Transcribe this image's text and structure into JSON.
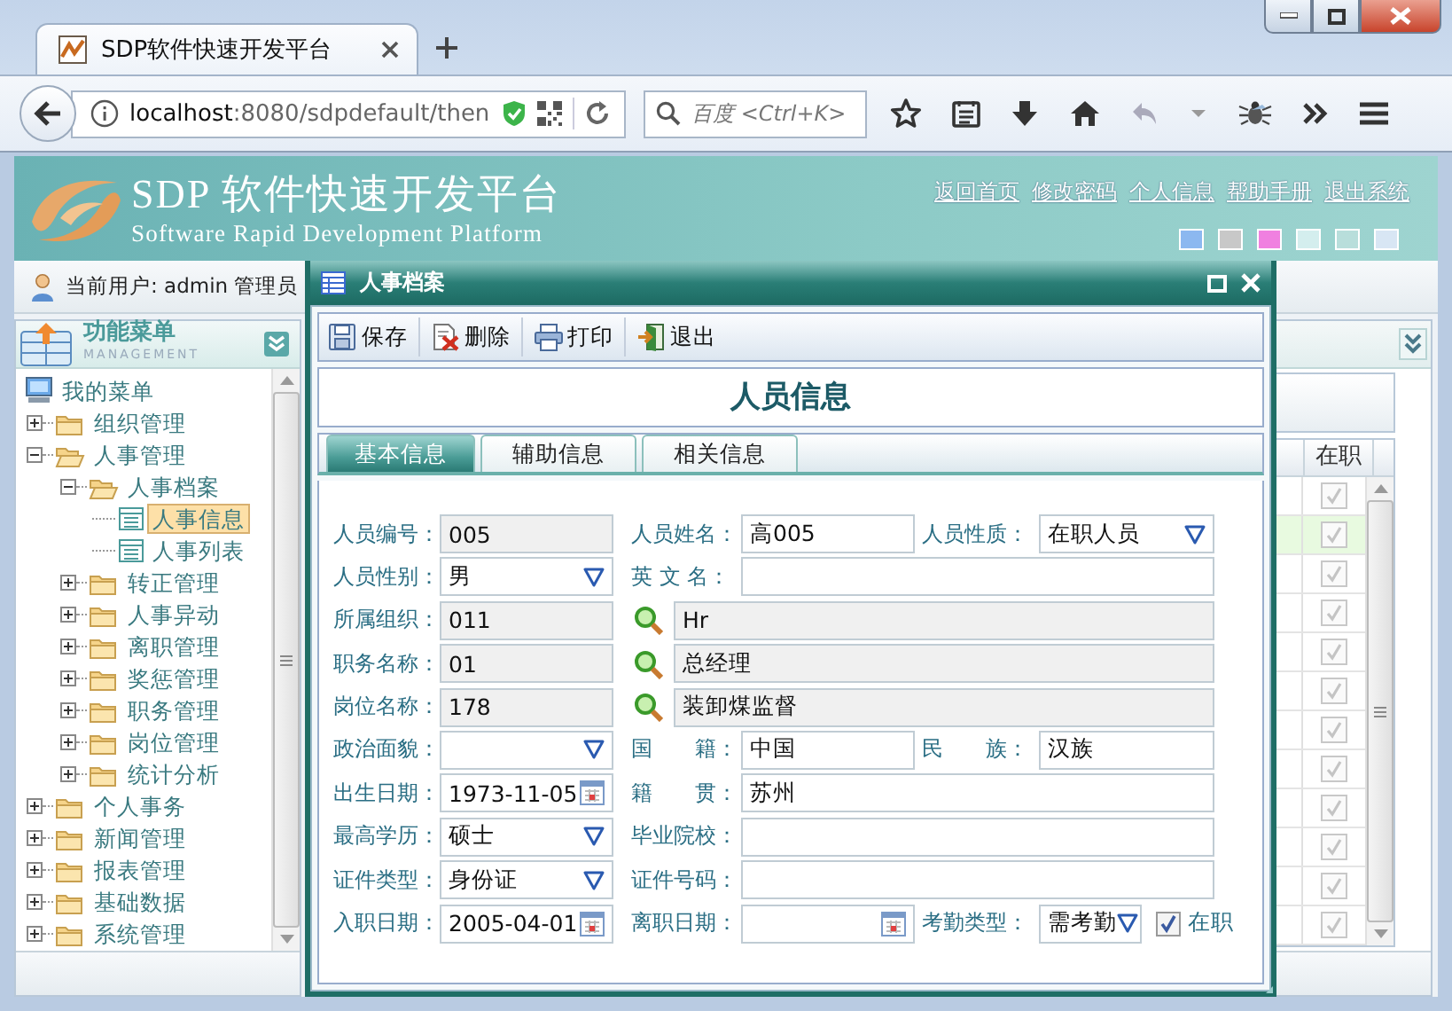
{
  "browser": {
    "tab_title": "SDP软件快速开发平台",
    "url_host": "localhost",
    "url_rest": ":8080/sdpdefault/then",
    "search_placeholder": "百度 <Ctrl+K>"
  },
  "header": {
    "title": "SDP 软件快速开发平台",
    "subtitle": "Software Rapid Development Platform",
    "links": [
      "返回首页",
      "修改密码",
      "个人信息",
      "帮助手册",
      "退出系统"
    ],
    "themes": [
      {
        "color": "#8cb8f0"
      },
      {
        "color": "#c8c8c8"
      },
      {
        "color": "#f080e0"
      },
      {
        "color": "#d4eeee"
      },
      {
        "color": "#b8dedb"
      },
      {
        "color": "#d8e6f4"
      }
    ]
  },
  "user_bar": {
    "text": "当前用户: admin 管理员"
  },
  "sidebar": {
    "title": "功能菜单",
    "subtitle": "MANAGEMENT",
    "tree": {
      "label": "我的菜单",
      "kind": "root",
      "selected": false,
      "children": [
        {
          "label": "组织管理",
          "kind": "folder",
          "expanded": false,
          "selected": false
        },
        {
          "label": "人事管理",
          "kind": "folder",
          "expanded": true,
          "selected": false,
          "children": [
            {
              "label": "人事档案",
              "kind": "folder",
              "expanded": true,
              "selected": false,
              "children": [
                {
                  "label": "人事信息",
                  "kind": "leaf",
                  "selected": true
                },
                {
                  "label": "人事列表",
                  "kind": "leaf",
                  "selected": false
                }
              ]
            },
            {
              "label": "转正管理",
              "kind": "folder",
              "expanded": false,
              "selected": false
            },
            {
              "label": "人事异动",
              "kind": "folder",
              "expanded": false,
              "selected": false
            },
            {
              "label": "离职管理",
              "kind": "folder",
              "expanded": false,
              "selected": false
            },
            {
              "label": "奖惩管理",
              "kind": "folder",
              "expanded": false,
              "selected": false
            },
            {
              "label": "职务管理",
              "kind": "folder",
              "expanded": false,
              "selected": false
            },
            {
              "label": "岗位管理",
              "kind": "folder",
              "expanded": false,
              "selected": false
            },
            {
              "label": "统计分析",
              "kind": "folder",
              "expanded": false,
              "selected": false
            }
          ]
        },
        {
          "label": "个人事务",
          "kind": "folder",
          "expanded": false,
          "selected": false
        },
        {
          "label": "新闻管理",
          "kind": "folder",
          "expanded": false,
          "selected": false
        },
        {
          "label": "报表管理",
          "kind": "folder",
          "expanded": false,
          "selected": false
        },
        {
          "label": "基础数据",
          "kind": "folder",
          "expanded": false,
          "selected": false
        },
        {
          "label": "系统管理",
          "kind": "folder",
          "expanded": false,
          "selected": false
        }
      ]
    }
  },
  "grid": {
    "columns": [
      "在职"
    ],
    "rows": [
      {
        "checked": true,
        "selected": false
      },
      {
        "checked": true,
        "selected": true
      },
      {
        "checked": true,
        "selected": false
      },
      {
        "checked": true,
        "selected": false
      },
      {
        "checked": true,
        "selected": false
      },
      {
        "checked": true,
        "selected": false
      },
      {
        "checked": true,
        "selected": false
      },
      {
        "checked": true,
        "selected": false
      },
      {
        "checked": true,
        "selected": false
      },
      {
        "checked": true,
        "selected": false
      },
      {
        "checked": true,
        "selected": false
      },
      {
        "checked": true,
        "selected": false
      }
    ]
  },
  "dialog": {
    "title": "人事档案",
    "toolbar": [
      {
        "label": "保存",
        "kind": "save"
      },
      {
        "label": "删除",
        "kind": "delete"
      },
      {
        "label": "打印",
        "kind": "print"
      },
      {
        "label": "退出",
        "kind": "exit"
      }
    ],
    "heading": "人员信息",
    "tabs": [
      {
        "label": "基本信息",
        "selected": true
      },
      {
        "label": "辅助信息",
        "selected": false
      },
      {
        "label": "相关信息",
        "selected": false
      }
    ],
    "form": [
      [
        {
          "label": "人员编号：",
          "value": "005",
          "kind": "text",
          "readonly": true,
          "wide": false
        },
        {
          "label": "人员姓名：",
          "value": "高005",
          "kind": "text",
          "readonly": false,
          "wide": false
        },
        {
          "label": "人员性质：",
          "value": "在职人员",
          "kind": "select",
          "readonly": false,
          "wide": false
        }
      ],
      [
        {
          "label": "人员性别：",
          "value": "男",
          "kind": "select",
          "readonly": false,
          "wide": false
        },
        {
          "label": "英 文 名：",
          "kind": "text",
          "readonly": false,
          "wide": true
        }
      ],
      [
        {
          "label": "所属组织：",
          "value": "011",
          "kind": "text",
          "readonly": true,
          "wide": false
        },
        {
          "value": "Hr",
          "kind": "lookup",
          "readonly": true
        }
      ],
      [
        {
          "label": "职务名称：",
          "value": "01",
          "kind": "text",
          "readonly": true,
          "wide": false
        },
        {
          "value": "总经理",
          "kind": "lookup",
          "readonly": true
        }
      ],
      [
        {
          "label": "岗位名称：",
          "value": "178",
          "kind": "text",
          "readonly": true,
          "wide": false
        },
        {
          "value": "装卸煤监督",
          "kind": "lookup",
          "readonly": true
        }
      ],
      [
        {
          "label": "政治面貌：",
          "kind": "select",
          "readonly": false,
          "wide": false
        },
        {
          "label": "国　　籍：",
          "value": "中国",
          "kind": "text",
          "readonly": false,
          "wide": false
        },
        {
          "label": "民　　族：",
          "value": "汉族",
          "kind": "text",
          "readonly": false,
          "wide": false
        }
      ],
      [
        {
          "label": "出生日期：",
          "value": "1973-11-05",
          "kind": "date",
          "readonly": false,
          "wide": false
        },
        {
          "label": "籍　　贯：",
          "value": "苏州",
          "kind": "text",
          "readonly": false,
          "wide": true
        }
      ],
      [
        {
          "label": "最高学历：",
          "value": "硕士",
          "kind": "select",
          "readonly": false,
          "wide": false
        },
        {
          "label": "毕业院校：",
          "kind": "text",
          "readonly": false,
          "wide": true
        }
      ],
      [
        {
          "label": "证件类型：",
          "value": "身份证",
          "kind": "select",
          "readonly": false,
          "wide": false
        },
        {
          "label": "证件号码：",
          "kind": "text",
          "readonly": false,
          "wide": true
        }
      ],
      [
        {
          "label": "入职日期：",
          "value": "2005-04-01",
          "kind": "date",
          "readonly": false,
          "wide": false
        },
        {
          "label": "离职日期：",
          "kind": "date",
          "readonly": false,
          "wide": false
        },
        {
          "label": "考勤类型：",
          "value": "需考勤",
          "kind": "select",
          "readonly": false,
          "wide": false
        },
        {
          "label": "在职",
          "kind": "check",
          "checked": true
        }
      ]
    ]
  }
}
